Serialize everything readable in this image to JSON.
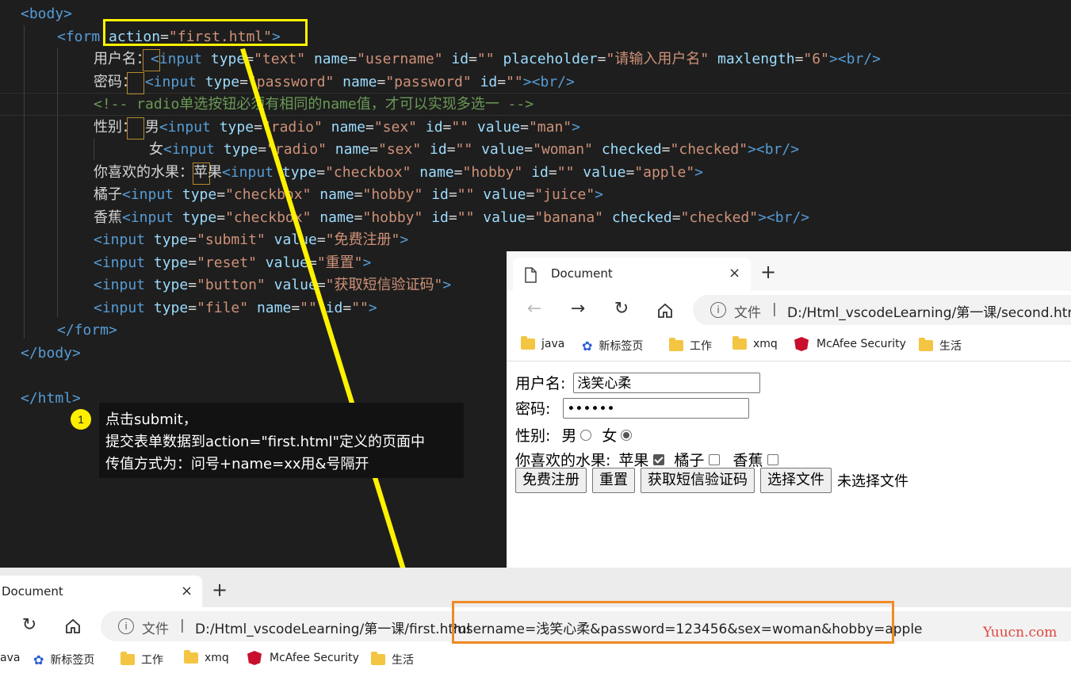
{
  "editor": {
    "lines": [
      {
        "parts": [
          [
            "tag",
            "<body>"
          ]
        ]
      },
      {
        "parts": [
          [
            "tag",
            "<form"
          ],
          [
            "txt",
            " "
          ],
          [
            "attr",
            "action"
          ],
          [
            "txt",
            "="
          ],
          [
            "str",
            "\"first.html\""
          ],
          [
            "tag",
            ">"
          ]
        ]
      },
      {
        "parts": [
          [
            "txt",
            "用户名："
          ],
          [
            "tag",
            "<input"
          ],
          [
            "txt",
            " "
          ],
          [
            "attr",
            "type"
          ],
          [
            "txt",
            "="
          ],
          [
            "str",
            "\"text\""
          ],
          [
            "txt",
            " "
          ],
          [
            "attr",
            "name"
          ],
          [
            "txt",
            "="
          ],
          [
            "str",
            "\"username\""
          ],
          [
            "txt",
            " "
          ],
          [
            "attr",
            "id"
          ],
          [
            "txt",
            "="
          ],
          [
            "str",
            "\"\""
          ],
          [
            "txt",
            " "
          ],
          [
            "attr",
            "placeholder"
          ],
          [
            "txt",
            "="
          ],
          [
            "str",
            "\"请输入用户名\""
          ],
          [
            "txt",
            " "
          ],
          [
            "attr",
            "maxlength"
          ],
          [
            "txt",
            "="
          ],
          [
            "str",
            "\"6\""
          ],
          [
            "tag",
            "><br/>"
          ]
        ]
      },
      {
        "parts": [
          [
            "txt",
            "密码： "
          ],
          [
            "tag",
            "<input"
          ],
          [
            "txt",
            " "
          ],
          [
            "attr",
            "type"
          ],
          [
            "txt",
            "="
          ],
          [
            "str",
            "\"password\""
          ],
          [
            "txt",
            " "
          ],
          [
            "attr",
            "name"
          ],
          [
            "txt",
            "="
          ],
          [
            "str",
            "\"password\""
          ],
          [
            "txt",
            " "
          ],
          [
            "attr",
            "id"
          ],
          [
            "txt",
            "="
          ],
          [
            "str",
            "\"\""
          ],
          [
            "tag",
            "><br/>"
          ]
        ]
      },
      {
        "parts": [
          [
            "cmt",
            "<!-- radio单选按钮必须有相同的name值，才可以实现多选一 -->"
          ]
        ]
      },
      {
        "parts": [
          [
            "txt",
            "性别： 男"
          ],
          [
            "tag",
            "<input"
          ],
          [
            "txt",
            " "
          ],
          [
            "attr",
            "type"
          ],
          [
            "txt",
            "="
          ],
          [
            "str",
            "\"radio\""
          ],
          [
            "txt",
            " "
          ],
          [
            "attr",
            "name"
          ],
          [
            "txt",
            "="
          ],
          [
            "str",
            "\"sex\""
          ],
          [
            "txt",
            " "
          ],
          [
            "attr",
            "id"
          ],
          [
            "txt",
            "="
          ],
          [
            "str",
            "\"\""
          ],
          [
            "txt",
            " "
          ],
          [
            "attr",
            "value"
          ],
          [
            "txt",
            "="
          ],
          [
            "str",
            "\"man\""
          ],
          [
            "tag",
            ">"
          ]
        ]
      },
      {
        "parts": [
          [
            "txt",
            "女"
          ],
          [
            "tag",
            "<input"
          ],
          [
            "txt",
            " "
          ],
          [
            "attr",
            "type"
          ],
          [
            "txt",
            "="
          ],
          [
            "str",
            "\"radio\""
          ],
          [
            "txt",
            " "
          ],
          [
            "attr",
            "name"
          ],
          [
            "txt",
            "="
          ],
          [
            "str",
            "\"sex\""
          ],
          [
            "txt",
            " "
          ],
          [
            "attr",
            "id"
          ],
          [
            "txt",
            "="
          ],
          [
            "str",
            "\"\""
          ],
          [
            "txt",
            " "
          ],
          [
            "attr",
            "value"
          ],
          [
            "txt",
            "="
          ],
          [
            "str",
            "\"woman\""
          ],
          [
            "txt",
            " "
          ],
          [
            "attr",
            "checked"
          ],
          [
            "txt",
            "="
          ],
          [
            "str",
            "\"checked\""
          ],
          [
            "tag",
            "><br/>"
          ]
        ]
      },
      {
        "parts": [
          [
            "txt",
            "你喜欢的水果：苹果"
          ],
          [
            "tag",
            "<input"
          ],
          [
            "txt",
            " "
          ],
          [
            "attr",
            "type"
          ],
          [
            "txt",
            "="
          ],
          [
            "str",
            "\"checkbox\""
          ],
          [
            "txt",
            " "
          ],
          [
            "attr",
            "name"
          ],
          [
            "txt",
            "="
          ],
          [
            "str",
            "\"hobby\""
          ],
          [
            "txt",
            " "
          ],
          [
            "attr",
            "id"
          ],
          [
            "txt",
            "="
          ],
          [
            "str",
            "\"\""
          ],
          [
            "txt",
            " "
          ],
          [
            "attr",
            "value"
          ],
          [
            "txt",
            "="
          ],
          [
            "str",
            "\"apple\""
          ],
          [
            "tag",
            ">"
          ]
        ]
      },
      {
        "parts": [
          [
            "txt",
            "橘子"
          ],
          [
            "tag",
            "<input"
          ],
          [
            "txt",
            " "
          ],
          [
            "attr",
            "type"
          ],
          [
            "txt",
            "="
          ],
          [
            "str",
            "\"checkbox\""
          ],
          [
            "txt",
            " "
          ],
          [
            "attr",
            "name"
          ],
          [
            "txt",
            "="
          ],
          [
            "str",
            "\"hobby\""
          ],
          [
            "txt",
            " "
          ],
          [
            "attr",
            "id"
          ],
          [
            "txt",
            "="
          ],
          [
            "str",
            "\"\""
          ],
          [
            "txt",
            " "
          ],
          [
            "attr",
            "value"
          ],
          [
            "txt",
            "="
          ],
          [
            "str",
            "\"juice\""
          ],
          [
            "tag",
            ">"
          ]
        ]
      },
      {
        "parts": [
          [
            "txt",
            "香蕉"
          ],
          [
            "tag",
            "<input"
          ],
          [
            "txt",
            " "
          ],
          [
            "attr",
            "type"
          ],
          [
            "txt",
            "="
          ],
          [
            "str",
            "\"checkbox\""
          ],
          [
            "txt",
            " "
          ],
          [
            "attr",
            "name"
          ],
          [
            "txt",
            "="
          ],
          [
            "str",
            "\"hobby\""
          ],
          [
            "txt",
            " "
          ],
          [
            "attr",
            "id"
          ],
          [
            "txt",
            "="
          ],
          [
            "str",
            "\"\""
          ],
          [
            "txt",
            " "
          ],
          [
            "attr",
            "value"
          ],
          [
            "txt",
            "="
          ],
          [
            "str",
            "\"banana\""
          ],
          [
            "txt",
            " "
          ],
          [
            "attr",
            "checked"
          ],
          [
            "txt",
            "="
          ],
          [
            "str",
            "\"checked\""
          ],
          [
            "tag",
            "><br/>"
          ]
        ]
      },
      {
        "parts": [
          [
            "tag",
            "<input"
          ],
          [
            "txt",
            " "
          ],
          [
            "attr",
            "type"
          ],
          [
            "txt",
            "="
          ],
          [
            "str",
            "\"submit\""
          ],
          [
            "txt",
            " "
          ],
          [
            "attr",
            "value"
          ],
          [
            "txt",
            "="
          ],
          [
            "str",
            "\"免费注册\""
          ],
          [
            "tag",
            ">"
          ]
        ]
      },
      {
        "parts": [
          [
            "tag",
            "<input"
          ],
          [
            "txt",
            " "
          ],
          [
            "attr",
            "type"
          ],
          [
            "txt",
            "="
          ],
          [
            "str",
            "\"reset\""
          ],
          [
            "txt",
            " "
          ],
          [
            "attr",
            "value"
          ],
          [
            "txt",
            "="
          ],
          [
            "str",
            "\"重置\""
          ],
          [
            "tag",
            ">"
          ]
        ]
      },
      {
        "parts": [
          [
            "tag",
            "<input"
          ],
          [
            "txt",
            " "
          ],
          [
            "attr",
            "type"
          ],
          [
            "txt",
            "="
          ],
          [
            "str",
            "\"button\""
          ],
          [
            "txt",
            " "
          ],
          [
            "attr",
            "value"
          ],
          [
            "txt",
            "="
          ],
          [
            "str",
            "\"获取短信验证码\""
          ],
          [
            "tag",
            ">"
          ]
        ]
      },
      {
        "parts": [
          [
            "tag",
            "<input"
          ],
          [
            "txt",
            " "
          ],
          [
            "attr",
            "type"
          ],
          [
            "txt",
            "="
          ],
          [
            "str",
            "\"file\""
          ],
          [
            "txt",
            " "
          ],
          [
            "attr",
            "name"
          ],
          [
            "txt",
            "="
          ],
          [
            "str",
            "\"\""
          ],
          [
            "txt",
            " "
          ],
          [
            "attr",
            "id"
          ],
          [
            "txt",
            "="
          ],
          [
            "str",
            "\"\""
          ],
          [
            "tag",
            ">"
          ]
        ]
      },
      {
        "parts": [
          [
            "tag",
            "</form>"
          ]
        ]
      },
      {
        "parts": [
          [
            "tag",
            "</body>"
          ]
        ]
      },
      {
        "parts": []
      },
      {
        "parts": [
          [
            "tag",
            "</html>"
          ]
        ]
      }
    ]
  },
  "annotation": {
    "badge": "1",
    "lines": [
      "点击submit，",
      "提交表单数据到action=\"first.html\"定义的页面中",
      "传值方式为：问号+name=xx用&号隔开"
    ]
  },
  "browser1": {
    "tab_title": "Document",
    "close": "×",
    "new_tab": "+",
    "info_label": "文件",
    "separator": "|",
    "address": "D:/Html_vscodeLearning/第一课/second.html",
    "bookmarks": [
      "java",
      "新标签页",
      "工作",
      "xmq",
      "McAfee Security",
      "生活"
    ],
    "form": {
      "username_label": "用户名:",
      "username_value": "浅笑心柔",
      "password_label": "密码:",
      "password_value": "••••••",
      "sex_label": "性别:",
      "male": "男",
      "female": "女",
      "fruit_label": "你喜欢的水果:",
      "apple": "苹果",
      "orange": "橘子",
      "banana": "香蕉",
      "submit": "免费注册",
      "reset": "重置",
      "sms": "获取短信验证码",
      "file_button": "选择文件",
      "file_status": "未选择文件"
    }
  },
  "browser2": {
    "tab_title": "Document",
    "close": "×",
    "new_tab": "+",
    "info_label": "文件",
    "separator": "|",
    "address_path": "D:/Html_vscodeLearning/第一课/first.html",
    "address_query": "?username=浅笑心柔&password=123456&sex=woman&hobby=apple",
    "bookmarks": [
      "ava",
      "新标签页",
      "工作",
      "xmq",
      "McAfee Security",
      "生活"
    ]
  },
  "watermark": "Yuucn.com",
  "colors": {
    "highlight_yellow": "#fff200",
    "highlight_orange": "#f08a24",
    "tag": "#569cd6",
    "attr": "#9cdcfe",
    "string": "#ce9178",
    "comment": "#6a9955"
  }
}
